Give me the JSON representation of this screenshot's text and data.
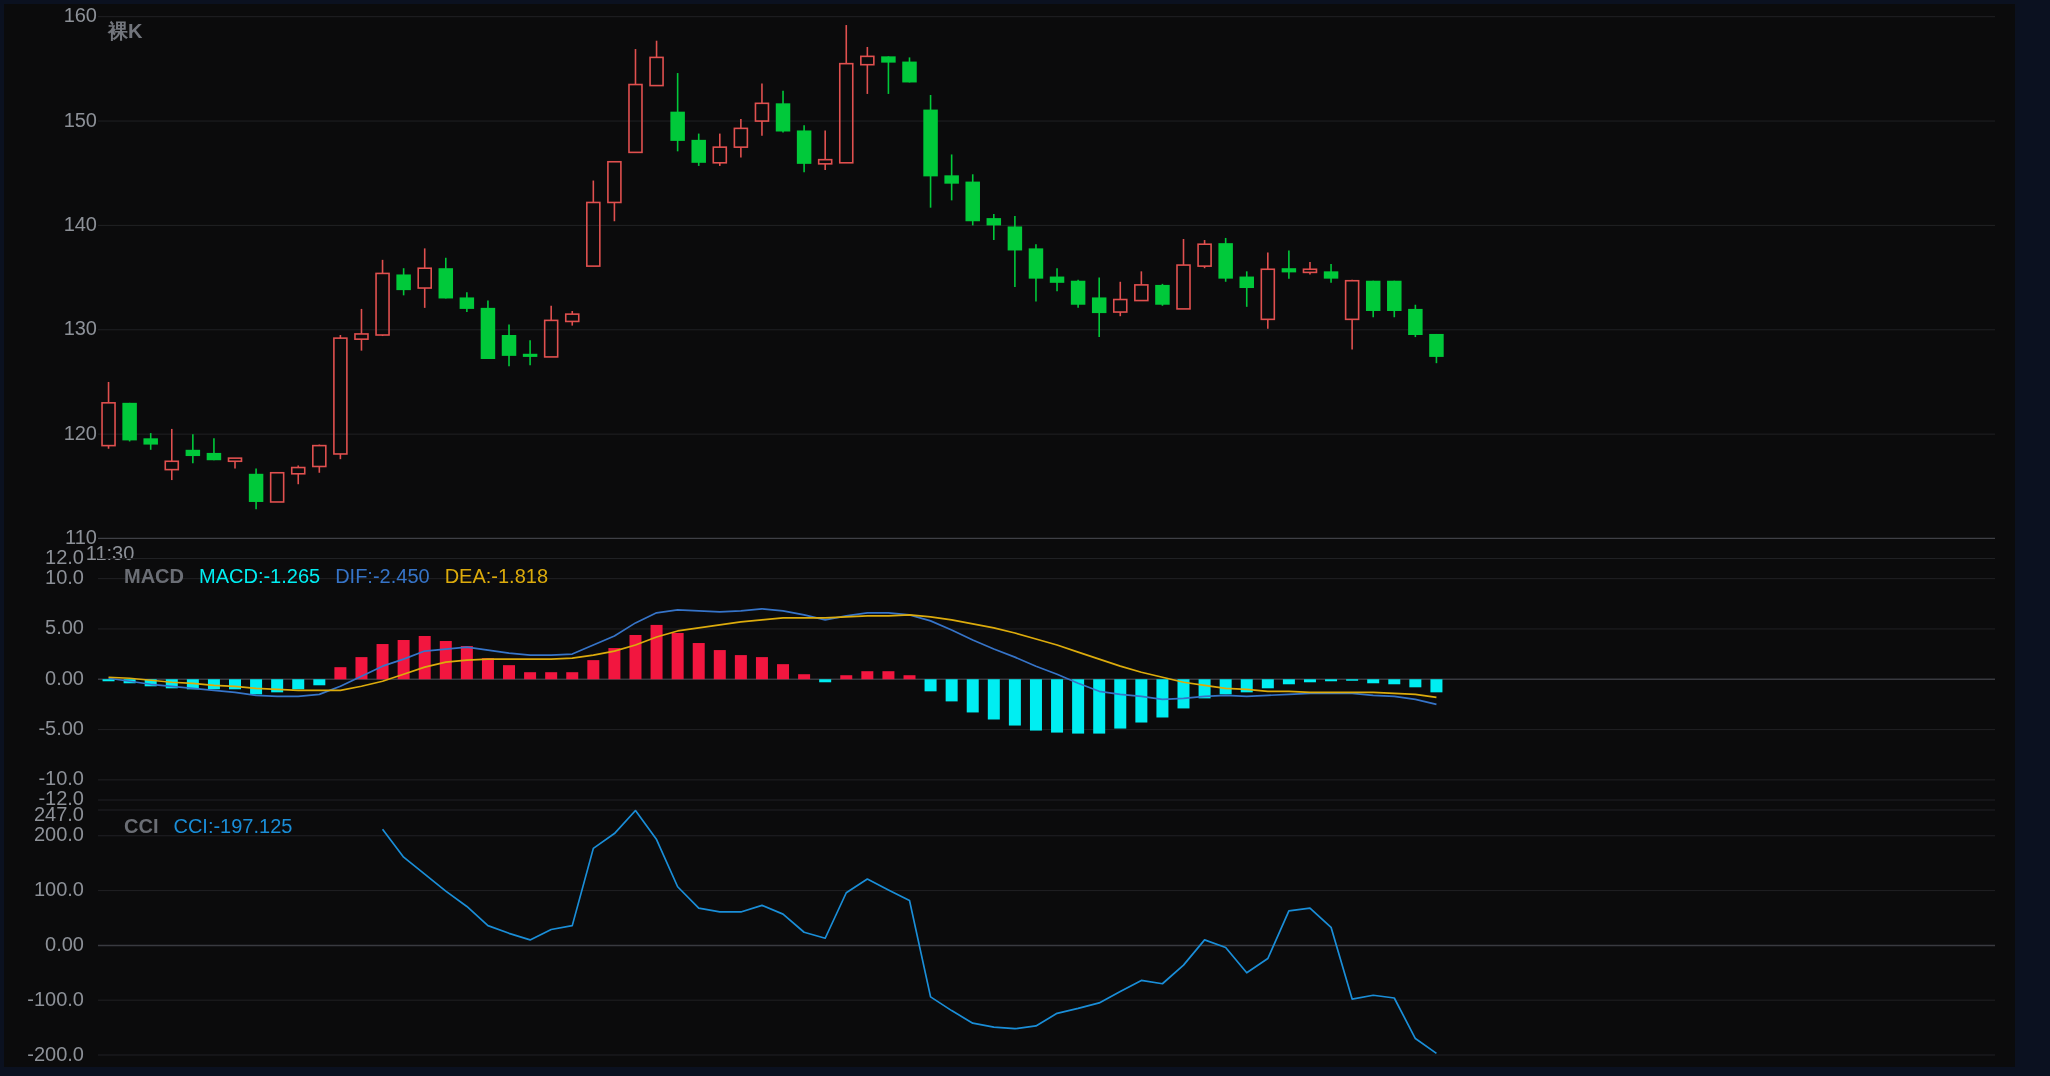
{
  "price_pane": {
    "title": "裸K",
    "time_label": "11:30",
    "chart_data": {
      "type": "candlestick",
      "grid": true,
      "ylim": [
        110,
        160
      ],
      "yticks": [
        {
          "value": 160,
          "label": "160"
        },
        {
          "value": 150,
          "label": "150"
        },
        {
          "value": 140,
          "label": "140"
        },
        {
          "value": 130,
          "label": "130"
        },
        {
          "value": 120,
          "label": "120"
        },
        {
          "value": 110,
          "label": "110"
        }
      ],
      "ohlc": [
        [
          118.9,
          125.0,
          118.6,
          123.0
        ],
        [
          123.0,
          123.0,
          119.3,
          119.4
        ],
        [
          119.6,
          120.1,
          118.5,
          119.0
        ],
        [
          116.6,
          120.5,
          115.6,
          117.4
        ],
        [
          118.5,
          120.0,
          117.2,
          117.9
        ],
        [
          118.2,
          119.6,
          117.5,
          117.5
        ],
        [
          117.4,
          117.7,
          116.7,
          117.7
        ],
        [
          116.2,
          116.7,
          112.8,
          113.5
        ],
        [
          113.5,
          116.3,
          113.5,
          116.3
        ],
        [
          116.2,
          117.0,
          115.2,
          116.8
        ],
        [
          116.9,
          119.0,
          116.3,
          118.9
        ],
        [
          118.1,
          129.5,
          117.6,
          129.2
        ],
        [
          129.1,
          132.0,
          128.0,
          129.6
        ],
        [
          129.5,
          136.7,
          129.4,
          135.4
        ],
        [
          135.3,
          135.9,
          133.3,
          133.8
        ],
        [
          134.0,
          137.8,
          132.1,
          135.9
        ],
        [
          135.9,
          136.9,
          133.0,
          133.0
        ],
        [
          133.1,
          133.6,
          131.7,
          132.0
        ],
        [
          132.1,
          132.8,
          127.2,
          127.2
        ],
        [
          129.5,
          130.5,
          126.5,
          127.5
        ],
        [
          127.7,
          129.0,
          126.6,
          127.4
        ],
        [
          127.4,
          132.3,
          127.4,
          130.9
        ],
        [
          130.8,
          131.8,
          130.4,
          131.5
        ],
        [
          136.1,
          144.3,
          136.1,
          142.2
        ],
        [
          142.2,
          146.1,
          140.4,
          146.1
        ],
        [
          147.0,
          156.9,
          147.0,
          153.5
        ],
        [
          153.4,
          157.7,
          153.4,
          156.1
        ],
        [
          150.9,
          154.6,
          147.1,
          148.1
        ],
        [
          148.2,
          148.8,
          145.7,
          146.0
        ],
        [
          146.0,
          148.8,
          145.7,
          147.5
        ],
        [
          147.5,
          150.2,
          146.5,
          149.3
        ],
        [
          150.0,
          153.6,
          148.6,
          151.7
        ],
        [
          151.7,
          152.9,
          148.9,
          149.0
        ],
        [
          149.1,
          149.6,
          145.1,
          145.9
        ],
        [
          145.9,
          149.1,
          145.3,
          146.3
        ],
        [
          146.0,
          159.2,
          146.0,
          155.5
        ],
        [
          155.4,
          157.1,
          152.6,
          156.2
        ],
        [
          156.2,
          156.2,
          152.6,
          155.6
        ],
        [
          155.7,
          156.1,
          153.7,
          153.7
        ],
        [
          151.1,
          152.5,
          141.7,
          144.7
        ],
        [
          144.8,
          146.8,
          142.4,
          144.0
        ],
        [
          144.2,
          144.9,
          140.0,
          140.4
        ],
        [
          140.7,
          141.1,
          138.6,
          140.0
        ],
        [
          139.9,
          140.9,
          134.1,
          137.6
        ],
        [
          137.8,
          138.2,
          132.7,
          134.9
        ],
        [
          135.1,
          135.9,
          133.7,
          134.5
        ],
        [
          134.7,
          134.8,
          132.1,
          132.4
        ],
        [
          133.1,
          135.0,
          129.3,
          131.6
        ],
        [
          131.7,
          134.6,
          131.3,
          132.9
        ],
        [
          132.8,
          135.6,
          132.8,
          134.3
        ],
        [
          134.3,
          134.4,
          132.3,
          132.4
        ],
        [
          132.0,
          138.7,
          132.0,
          136.2
        ],
        [
          136.1,
          138.6,
          135.9,
          138.2
        ],
        [
          138.3,
          138.8,
          134.6,
          134.9
        ],
        [
          135.1,
          135.6,
          132.2,
          134.0
        ],
        [
          131.0,
          137.4,
          130.1,
          135.8
        ],
        [
          135.9,
          137.6,
          134.9,
          135.5
        ],
        [
          135.5,
          136.5,
          135.3,
          135.8
        ],
        [
          135.6,
          136.3,
          134.5,
          134.9
        ],
        [
          131.0,
          134.8,
          128.1,
          134.7
        ],
        [
          134.7,
          134.7,
          131.2,
          131.8
        ],
        [
          134.7,
          134.7,
          131.2,
          131.8
        ],
        [
          132.0,
          132.4,
          129.3,
          129.5
        ],
        [
          129.6,
          129.6,
          126.8,
          127.4
        ],
        null,
        null,
        null,
        null,
        null,
        null,
        null,
        null,
        null,
        null,
        null,
        null,
        null,
        null,
        null,
        null,
        null,
        null,
        null,
        null,
        null,
        null,
        null,
        null,
        null,
        null
      ]
    }
  },
  "macd_pane": {
    "title": "MACD",
    "chart_data": {
      "type": "bar",
      "stacked": true,
      "grid": true,
      "ylim": [
        -12,
        12
      ],
      "yticks": [
        {
          "value": 12,
          "label": "12.0"
        },
        {
          "value": 10,
          "label": "10.0"
        },
        {
          "value": 5,
          "label": "5.00"
        },
        {
          "value": 0,
          "label": "0.00"
        },
        {
          "value": -5,
          "label": "-5.00"
        },
        {
          "value": -10,
          "label": "-10.0"
        },
        {
          "value": -12,
          "label": "-12.0"
        }
      ],
      "series": [
        {
          "name": "MACD:-1.265",
          "color": "#00eef2",
          "values": [
            -0.2,
            -0.4,
            -0.7,
            -0.9,
            -1.0,
            -1.0,
            -1.0,
            -1.5,
            -1.3,
            -1.0,
            -0.6,
            null,
            null,
            null,
            null,
            null,
            null,
            null,
            null,
            null,
            null,
            null,
            null,
            null,
            null,
            null,
            null,
            null,
            null,
            null,
            null,
            null,
            null,
            null,
            -0.3,
            null,
            null,
            null,
            null,
            -1.2,
            -2.2,
            -3.3,
            -4.0,
            -4.6,
            -5.1,
            -5.3,
            -5.4,
            -5.4,
            -4.9,
            -4.3,
            -3.8,
            -2.9,
            -1.9,
            -1.5,
            -1.3,
            -0.9,
            -0.5,
            -0.3,
            -0.2,
            -0.1,
            -0.4,
            -0.5,
            -0.8,
            -1.3
          ]
        },
        {
          "color": "#f2163f",
          "values": [
            null,
            null,
            null,
            null,
            null,
            null,
            null,
            null,
            null,
            null,
            null,
            1.2,
            2.2,
            3.5,
            3.9,
            4.3,
            3.8,
            3.3,
            2.1,
            1.4,
            0.7,
            0.7,
            0.7,
            1.9,
            3.1,
            4.4,
            5.4,
            4.6,
            3.6,
            2.9,
            2.4,
            2.2,
            1.5,
            0.5,
            null,
            0.4,
            0.8,
            0.8,
            0.4,
            null,
            null,
            null,
            null,
            null,
            null,
            null,
            null,
            null,
            null,
            null,
            null,
            null,
            null,
            null,
            null,
            null,
            null,
            null,
            null,
            null,
            null,
            null,
            null,
            null
          ]
        },
        {
          "name": "DIF:-2.450",
          "type": "line",
          "color": "#3674c8",
          "values": [
            0.1,
            -0.2,
            -0.5,
            -0.7,
            -0.9,
            -1.1,
            -1.3,
            -1.6,
            -1.7,
            -1.7,
            -1.5,
            -0.7,
            0.3,
            1.3,
            2.0,
            2.8,
            3.0,
            3.2,
            2.9,
            2.6,
            2.4,
            2.4,
            2.5,
            3.4,
            4.3,
            5.6,
            6.6,
            6.9,
            6.8,
            6.7,
            6.8,
            7.0,
            6.8,
            6.4,
            5.9,
            6.3,
            6.6,
            6.6,
            6.4,
            5.8,
            4.9,
            3.9,
            3.0,
            2.2,
            1.3,
            0.5,
            -0.4,
            -1.2,
            -1.5,
            -1.7,
            -2.0,
            -1.9,
            -1.7,
            -1.6,
            -1.7,
            -1.6,
            -1.5,
            -1.4,
            -1.4,
            -1.4,
            -1.6,
            -1.7,
            -2.0,
            -2.5
          ]
        },
        {
          "name": "DEA:-1.818",
          "type": "line",
          "color": "#dcab0c",
          "values": [
            0.2,
            0.1,
            -0.1,
            -0.3,
            -0.4,
            -0.6,
            -0.7,
            -0.9,
            -1.0,
            -1.1,
            -1.1,
            -1.1,
            -0.7,
            -0.2,
            0.5,
            1.2,
            1.7,
            1.9,
            2.0,
            2.0,
            2.0,
            2.0,
            2.1,
            2.4,
            2.8,
            3.4,
            4.2,
            4.8,
            5.1,
            5.4,
            5.7,
            5.9,
            6.1,
            6.1,
            6.1,
            6.2,
            6.3,
            6.3,
            6.4,
            6.2,
            5.9,
            5.5,
            5.1,
            4.6,
            4.0,
            3.4,
            2.7,
            2.0,
            1.3,
            0.7,
            0.2,
            -0.3,
            -0.6,
            -0.9,
            -1.0,
            -1.2,
            -1.2,
            -1.3,
            -1.3,
            -1.3,
            -1.3,
            -1.4,
            -1.5,
            -1.8
          ]
        }
      ]
    }
  },
  "cci_pane": {
    "title": "CCI",
    "chart_data": {
      "type": "line",
      "grid": true,
      "ylim": [
        -200,
        247
      ],
      "yticks": [
        {
          "value": 247,
          "label": "247.0"
        },
        {
          "value": 200,
          "label": "200.0"
        },
        {
          "value": 100,
          "label": "100.0"
        },
        {
          "value": 0,
          "label": "0.00"
        },
        {
          "value": -100,
          "label": "-100.0"
        },
        {
          "value": -200,
          "label": "-200.0"
        }
      ],
      "series": [
        {
          "name": "CCI:-197.125",
          "color": "#1a8ed8",
          "values": [
            null,
            null,
            null,
            null,
            null,
            null,
            null,
            null,
            null,
            null,
            null,
            null,
            null,
            212,
            161,
            130,
            99,
            71,
            36,
            22,
            10,
            29,
            36,
            177,
            204,
            246,
            193,
            107,
            68,
            61,
            61,
            73,
            57,
            24,
            13,
            96,
            121,
            101,
            82,
            -94,
            -119,
            -142,
            -149,
            -152,
            -147,
            -124,
            -115,
            -105,
            -84,
            -64,
            -70,
            -36,
            10,
            -4,
            -50,
            -24,
            63,
            68,
            33,
            -98,
            -91,
            -96,
            -170,
            -197
          ]
        }
      ]
    }
  }
}
